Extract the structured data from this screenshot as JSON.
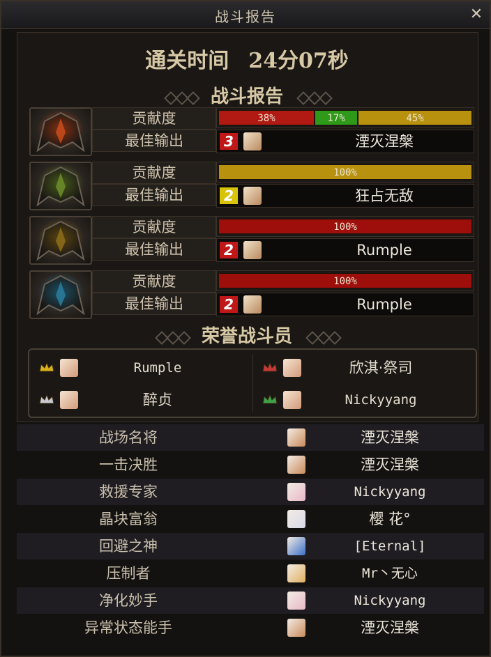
{
  "window": {
    "title": "战斗报告",
    "close_label": "✕"
  },
  "clear_time": {
    "label": "通关时间",
    "value": "24分07秒"
  },
  "sections": {
    "report": "战斗报告",
    "honor": "荣誉战斗员"
  },
  "row_labels": {
    "contribution": "贡献度",
    "best_output": "最佳输出"
  },
  "bosses": [
    {
      "icon": "fire-boss-icon",
      "color": "#c44a1c",
      "segments": [
        {
          "label": "38%",
          "value": 38,
          "color": "#b01a12"
        },
        {
          "label": "17%",
          "value": 17,
          "color": "#2f9a1a"
        },
        {
          "label": "45%",
          "value": 45,
          "color": "#b8920e"
        }
      ],
      "best": {
        "rank": "3",
        "rank_color": "#c01818",
        "name": "湮灭涅槃"
      }
    },
    {
      "icon": "poison-boss-icon",
      "color": "#6a8a2a",
      "segments": [
        {
          "label": "100%",
          "value": 100,
          "color": "#b8920e"
        }
      ],
      "best": {
        "rank": "2",
        "rank_color": "#d8c20a",
        "name": "狂占无敌"
      }
    },
    {
      "icon": "earth-boss-icon",
      "color": "#8a6a1a",
      "segments": [
        {
          "label": "100%",
          "value": 100,
          "color": "#9e0f0c"
        }
      ],
      "best": {
        "rank": "2",
        "rank_color": "#c01818",
        "name": "Rumple"
      }
    },
    {
      "icon": "ice-boss-icon",
      "color": "#2a7a9a",
      "segments": [
        {
          "label": "100%",
          "value": 100,
          "color": "#9e0f0c"
        }
      ],
      "best": {
        "rank": "2",
        "rank_color": "#c01818",
        "name": "Rumple"
      }
    }
  ],
  "honor": [
    {
      "name": "Rumple",
      "crown": "gold"
    },
    {
      "name": "欣淇·祭司",
      "crown": "red"
    },
    {
      "name": "醉贞",
      "crown": "silver"
    },
    {
      "name": "Nickyyang",
      "crown": "green"
    }
  ],
  "awards": [
    {
      "title": "战场名将",
      "player": "湮灭涅槃"
    },
    {
      "title": "一击决胜",
      "player": "湮灭涅槃"
    },
    {
      "title": "救援专家",
      "player": "Nickyyang"
    },
    {
      "title": "晶块富翁",
      "player": "樱 花°"
    },
    {
      "title": "回避之神",
      "player": "[Eternal]"
    },
    {
      "title": "压制者",
      "player": "Mr丶无心"
    },
    {
      "title": "净化妙手",
      "player": "Nickyyang"
    },
    {
      "title": "异常状态能手",
      "player": "湮灭涅槃"
    }
  ]
}
